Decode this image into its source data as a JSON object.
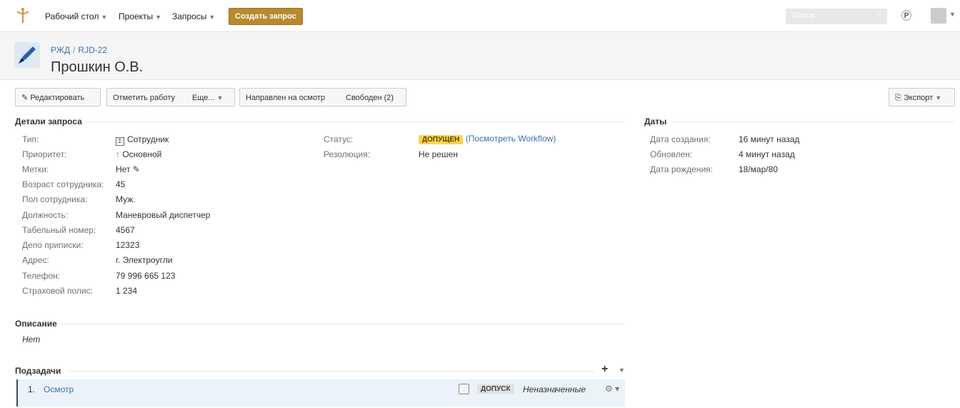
{
  "nav": {
    "dashboard": "Рабочий стол",
    "projects": "Проекты",
    "issues": "Запросы",
    "create": "Создать запрос",
    "search_placeholder": "Поиск"
  },
  "header": {
    "project": "РЖД",
    "issue_key": "RJD-22",
    "title": "Прошкин О.В."
  },
  "toolbar": {
    "edit": "Редактировать",
    "log_work": "Отметить работу",
    "more": "Еще...",
    "sent_inspection": "Направлен на осмотр",
    "free": "Свободен (2)",
    "export": "Экспорт"
  },
  "details": {
    "title": "Детали запроса",
    "fields": [
      {
        "label": "Тип:",
        "value": "Сотрудник"
      },
      {
        "label": "Приоритет:",
        "value": "Основной"
      },
      {
        "label": "Метки:",
        "value": "Нет"
      },
      {
        "label": "Возраст сотрудника:",
        "value": "45"
      },
      {
        "label": "Пол сотрудника:",
        "value": "Муж."
      },
      {
        "label": "Должность:",
        "value": "Маневровый диспетчер"
      },
      {
        "label": "Табельный номер:",
        "value": "4567"
      },
      {
        "label": "Депо приписки:",
        "value": "12323"
      },
      {
        "label": "Адрес:",
        "value": "г. Электроугли"
      },
      {
        "label": "Телефон:",
        "value": "79 996 665 123"
      },
      {
        "label": "Страховой полис:",
        "value": "1 234"
      }
    ],
    "status_label": "Статус:",
    "status_value": "допущен",
    "workflow_link": "(Посмотреть Workflow)",
    "resolution_label": "Резолюция:",
    "resolution_value": "Не решен"
  },
  "dates": {
    "title": "Даты",
    "fields": [
      {
        "label": "Дата создания:",
        "value": "16 минут назад"
      },
      {
        "label": "Обновлен:",
        "value": "4 минут назад"
      },
      {
        "label": "Дата рождения:",
        "value": "18/мар/80"
      }
    ]
  },
  "description": {
    "title": "Описание",
    "value": "Нет"
  },
  "subtasks": {
    "title": "Подзадачи",
    "items": [
      {
        "num": "1.",
        "name": "Осмотр",
        "status": "допуск",
        "assignee": "Неназначенные"
      }
    ]
  },
  "colors": {
    "accent": "#b88a2f",
    "link": "#3b73af",
    "status_badge": "#ffd351"
  }
}
